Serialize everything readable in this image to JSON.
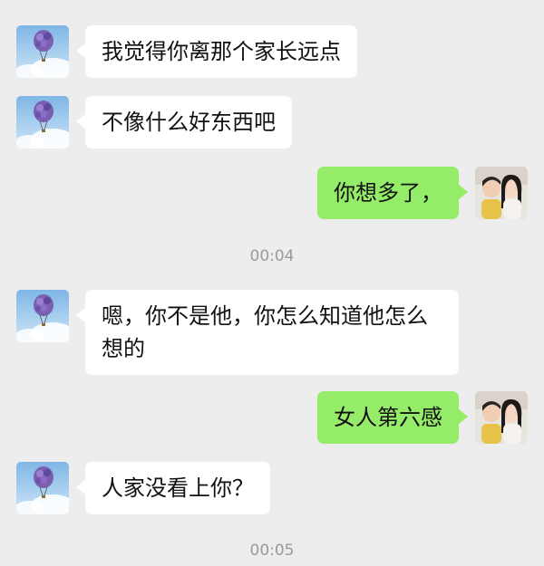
{
  "colors": {
    "background": "#ededed",
    "incoming_bubble": "#ffffff",
    "outgoing_bubble": "#95ec69",
    "timestamp": "#9a9a9a"
  },
  "contact_avatar_icon": "hot-air-balloon-avatar",
  "self_avatar_icon": "couple-photo-avatar",
  "messages": [
    {
      "side": "in",
      "text": "我觉得你离那个家长远点"
    },
    {
      "side": "in",
      "text": "不像什么好东西吧"
    },
    {
      "side": "out",
      "text": "你想多了，"
    },
    {
      "type": "time",
      "text": "00:04"
    },
    {
      "side": "in",
      "text": "嗯，你不是他，你怎么知道他怎么想的"
    },
    {
      "side": "out",
      "text": "女人第六感"
    },
    {
      "side": "in",
      "text": "人家没看上你？"
    },
    {
      "type": "time",
      "text": "00:05"
    }
  ]
}
